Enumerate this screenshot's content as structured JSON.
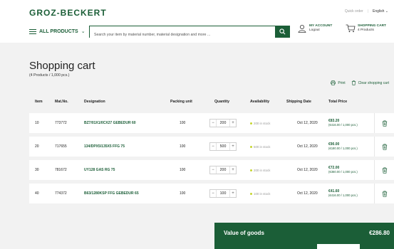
{
  "header": {
    "logo": "GROZ-BECKERT",
    "quick_order": "Quick order",
    "separator": "|",
    "language": "English",
    "all_products": "ALL PRODUCTS",
    "search_placeholder": "Search your item by material number, material designation and more ...",
    "account_label": "MY ACCOUNT",
    "account_sub": "Logout",
    "cart_label": "SHOPPING CART",
    "cart_sub": "4 Products"
  },
  "page": {
    "title": "Shopping cart",
    "subtitle": "(4 Products / 1,000 pcs.)",
    "print": "Print",
    "clear": "Clear shopping cart"
  },
  "table": {
    "columns": [
      "Item",
      "Mat.No.",
      "Designation",
      "Packing unit",
      "Quantity",
      "Availability",
      "Shipping Date",
      "Total Price"
    ],
    "rows": [
      {
        "item": "10",
        "matno": "773772",
        "designation": "BZ7/01X1/0CX27 GEBEDUR 60",
        "packing": "100",
        "qty": "200",
        "availability": "200 in stock",
        "ship": "Oct 12, 2020",
        "total": "€83.20",
        "unit": "(€416.00 / 1,000 pcs.)"
      },
      {
        "item": "20",
        "matno": "717655",
        "designation": "134/DPX5/135X5 FFG 75",
        "packing": "100",
        "qty": "500",
        "availability": "500 in stock",
        "ship": "Oct 12, 2020",
        "total": "€90.00",
        "unit": "(€180.00 / 1,000 pcs.)"
      },
      {
        "item": "30",
        "matno": "781672",
        "designation": "UY128 GAS RG 75",
        "packing": "100",
        "qty": "200",
        "availability": "200 in stock",
        "ship": "Oct 12, 2020",
        "total": "€72.00",
        "unit": "(€360.00 / 1,000 pcs.)"
      },
      {
        "item": "40",
        "matno": "774372",
        "designation": "B63/1280KSP FFG GEBEDUR 65",
        "packing": "100",
        "qty": "100",
        "availability": "100 in stock",
        "ship": "Oct 12, 2020",
        "total": "€41.60",
        "unit": "(€416.00 / 1,000 pcs.)"
      }
    ],
    "minus": "−",
    "plus": "+"
  },
  "summary": {
    "label": "Value of goods",
    "value": "€286.80"
  },
  "colors": {
    "brand": "#1b5e37",
    "background": "#f2f2f2",
    "stock_dot": "#c6d630"
  }
}
